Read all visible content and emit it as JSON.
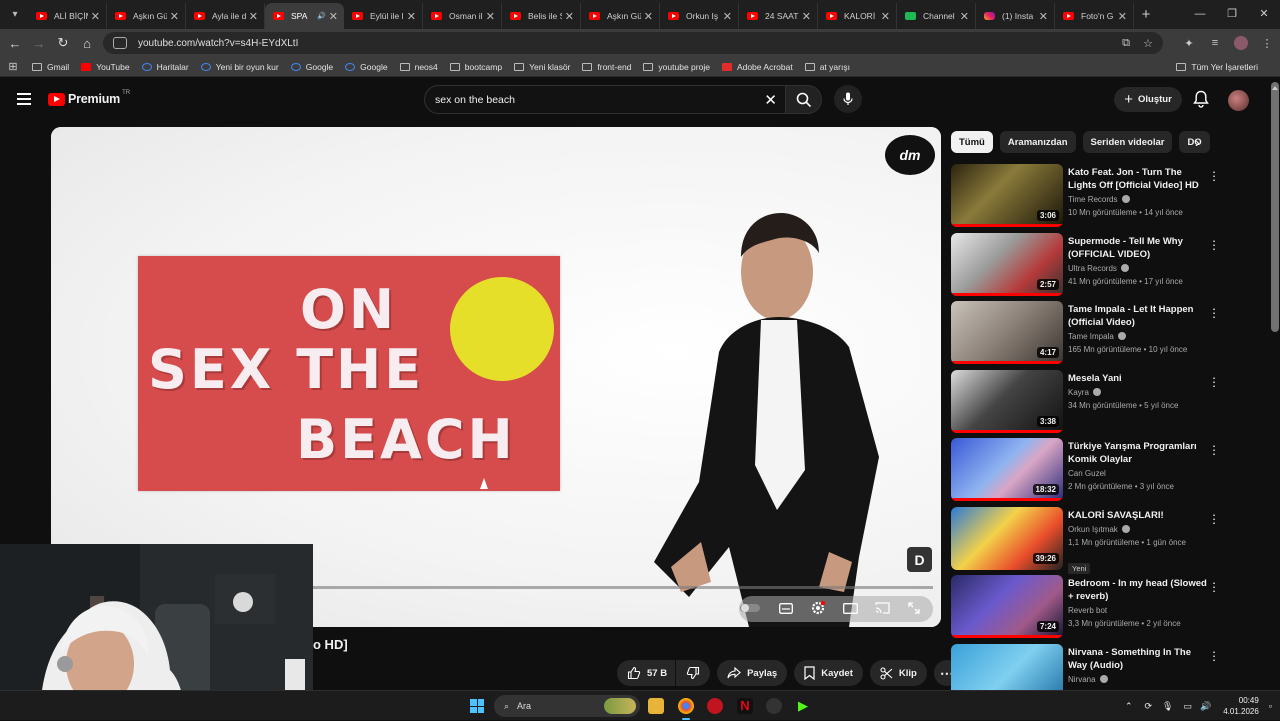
{
  "browser": {
    "tabs": [
      {
        "label": "ALİ BİÇİM",
        "icon": "youtube"
      },
      {
        "label": "Aşkın Gü",
        "icon": "youtube"
      },
      {
        "label": "Ayla ile d",
        "icon": "youtube"
      },
      {
        "label": "SPA",
        "icon": "youtube",
        "active": true
      },
      {
        "label": "Eylül ile l",
        "icon": "youtube"
      },
      {
        "label": "Osman ili",
        "icon": "youtube"
      },
      {
        "label": "Belis ile S",
        "icon": "youtube"
      },
      {
        "label": "Aşkın Gü",
        "icon": "youtube"
      },
      {
        "label": "Orkun Iş",
        "icon": "youtube"
      },
      {
        "label": "24 SAAT",
        "icon": "youtube"
      },
      {
        "label": "KALORİ S",
        "icon": "youtube"
      },
      {
        "label": "Channel",
        "icon": "kick"
      },
      {
        "label": "(1) Insta",
        "icon": "instagram"
      },
      {
        "label": "Foto'n G",
        "icon": "youtube"
      }
    ],
    "url": "youtube.com/watch?v=s4H-EYdXLtI",
    "bookmarks": [
      "Gmail",
      "YouTube",
      "Haritalar",
      "Yeni bir oyun kur",
      "Google",
      "Google",
      "neos4",
      "bootcamp",
      "Yeni klasör",
      "front-end",
      "youtube proje",
      "Adobe Acrobat",
      "at yarışı"
    ],
    "all_bookmarks": "Tüm Yer İşaretleri"
  },
  "youtube": {
    "logo": "Premium",
    "country": "TR",
    "search_query": "sex on the beach",
    "create_label": "Oluştur"
  },
  "video": {
    "overlay_lines": [
      "ON",
      "SEX THE",
      "BEACH"
    ],
    "title_fragment": "o HD]",
    "likes": "57 B",
    "share": "Paylaş",
    "save": "Kaydet",
    "clip": "Klip"
  },
  "chips": [
    "Tümü",
    "Aramanızdan",
    "Seriden videolar",
    "DO"
  ],
  "recommendations": [
    {
      "title": "Kato Feat. Jon - Turn The Lights Off [Official Video] HD",
      "channel": "Time Records",
      "verified": true,
      "stats": "10 Mn görüntüleme • 14 yıl önce",
      "duration": "3:06",
      "progress": 1.0,
      "bg": "linear-gradient(135deg,#2b2410,#8a7a3a 40%,#1a1508)"
    },
    {
      "title": "Supermode - Tell Me Why (OFFICIAL VIDEO)",
      "channel": "Ultra Records",
      "verified": true,
      "stats": "41 Mn görüntüleme • 17 yıl önce",
      "duration": "2:57",
      "progress": 1.0,
      "bg": "linear-gradient(135deg,#e8e8e8,#9a9a9a 40%,#b53a3a 70%,#333)"
    },
    {
      "title": "Tame Impala - Let It Happen (Official Video)",
      "channel": "Tame Impala",
      "verified": true,
      "stats": "165 Mn görüntüleme • 10 yıl önce",
      "duration": "4:17",
      "progress": 1.0,
      "bg": "linear-gradient(135deg,#c9c3ba,#8a7f76 50%,#3a3430)"
    },
    {
      "title": "Mesela Yani",
      "channel": "Kayra",
      "verified": true,
      "stats": "34 Mn görüntüleme • 5 yıl önce",
      "duration": "3:38",
      "progress": 1.0,
      "bg": "linear-gradient(135deg,#ddd,#444 45%,#111)"
    },
    {
      "title": "Türkiye Yarışma Programları Komik Olaylar",
      "channel": "Can Guzel",
      "verified": false,
      "stats": "2 Mn görüntüleme • 3 yıl önce",
      "duration": "18:32",
      "progress": 1.0,
      "bg": "linear-gradient(135deg,#3a58d8,#8fb4f0 45%,#d9a6c4 60%,#2a2a7a)"
    },
    {
      "title": "KALORİ SAVAŞLARI!",
      "channel": "Orkun Işıtmak",
      "verified": true,
      "stats": "1,1 Mn görüntüleme • 1 gün önce",
      "badge": "Yeni",
      "duration": "39:26",
      "progress": 0.0,
      "bg": "linear-gradient(135deg,#2c7ad6,#f3d24a 40%,#e84d2a 70%,#222)"
    },
    {
      "title": "Bedroom - In my head (Slowed + reverb)",
      "channel": "Reverb bot",
      "verified": false,
      "stats": "3,3 Mn görüntüleme • 2 yıl önce",
      "duration": "7:24",
      "progress": 1.0,
      "bg": "linear-gradient(135deg,#2b2a66,#6a5acd 40%,#a05a8a 70%,#151530)"
    },
    {
      "title": "Nirvana - Something In The Way (Audio)",
      "channel": "Nirvana",
      "verified": true,
      "stats": "",
      "duration": "",
      "progress": 0.0,
      "bg": "linear-gradient(135deg,#3aa0d8,#7fd0f0 50%,#1a6aa0)"
    }
  ],
  "taskbar": {
    "search_placeholder": "Ara",
    "time": "00:49",
    "date": "4.01.2026"
  }
}
